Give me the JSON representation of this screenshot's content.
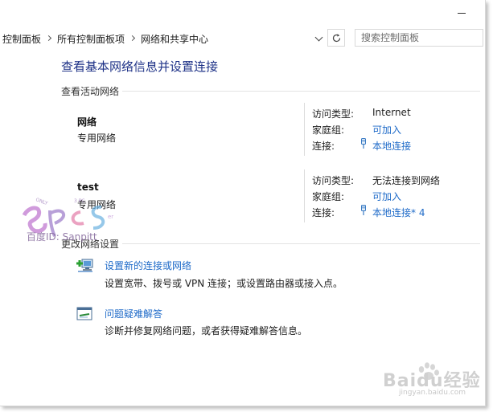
{
  "address_bar": {
    "breadcrumbs": [
      "控制面板",
      "所有控制面板项",
      "网络和共享中心"
    ],
    "search_placeholder": "搜索控制面板"
  },
  "main": {
    "title": "查看基本网络信息并设置连接",
    "active_networks_header": "查看活动网络",
    "networks": [
      {
        "name": "网络",
        "category": "专用网络",
        "access_type_label": "访问类型:",
        "access_type_value": "Internet",
        "homegroup_label": "家庭组:",
        "homegroup_value": "可加入",
        "connection_label": "连接:",
        "connection_value": "本地连接",
        "connection_icon": "ethernet-icon"
      },
      {
        "name": "test",
        "category": "专用网络",
        "access_type_label": "访问类型:",
        "access_type_value": "无法连接到网络",
        "homegroup_label": "家庭组:",
        "homegroup_value": "可加入",
        "connection_label": "连接:",
        "connection_value": "本地连接* 4",
        "connection_icon": "ethernet-icon"
      }
    ],
    "change_settings_header": "更改网络设置",
    "tasks": [
      {
        "link": "设置新的连接或网络",
        "description": "设置宽带、拨号或 VPN 连接；或设置路由器或接入点。",
        "icon": "new-connection-icon"
      },
      {
        "link": "问题疑难解答",
        "description": "诊断并修复网络问题，或者获得疑难解答信息。",
        "icon": "troubleshoot-icon"
      }
    ]
  },
  "watermarks": {
    "left_logo_id": "百度ID: Sanpitt",
    "right_brand": "Baidu经验",
    "right_url": "jingyan.baidu.com"
  },
  "colors": {
    "title": "#1e3287",
    "link": "#1e6ac8",
    "divider": "#e3e3e3"
  }
}
